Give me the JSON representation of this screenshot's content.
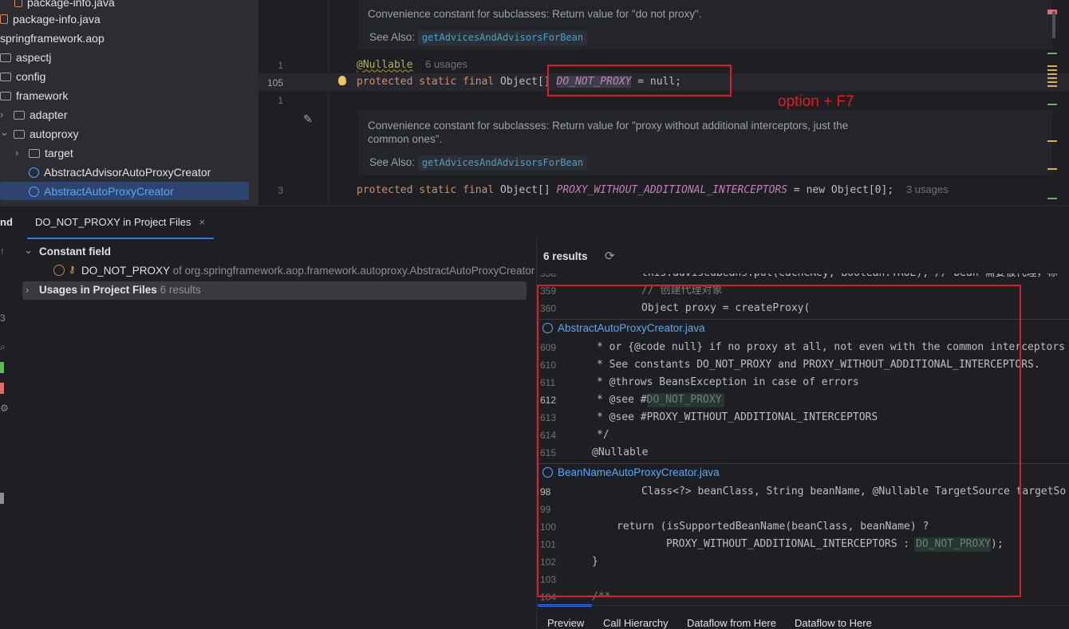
{
  "project_tree": {
    "items": [
      {
        "label": "package-info.java"
      },
      {
        "label": "package-info.java"
      },
      {
        "label": "springframework.aop"
      },
      {
        "label": "aspectj"
      },
      {
        "label": "config"
      },
      {
        "label": "framework"
      },
      {
        "label": "adapter"
      },
      {
        "label": "autoproxy"
      },
      {
        "label": "target"
      },
      {
        "label": "AbstractAdvisorAutoProxyCreator"
      },
      {
        "label": "AbstractAutoProxyCreator"
      }
    ]
  },
  "editor": {
    "doc1_text": "Convenience constant for subclasses: Return value for \"do not proxy\".",
    "see_also_label": "See Also:",
    "see_also_link": "getAdvicesAndAdvisorsForBean",
    "gutter": [
      "1",
      "105",
      "1",
      "3"
    ],
    "annotation": "@Nullable",
    "annotation_usages": "6 usages",
    "line105": {
      "kw1": "protected",
      "kw2": "static",
      "kw3": "final",
      "type": "Object[]",
      "name": "DO_NOT_PROXY",
      "rest": " = null;"
    },
    "doc2_text": "Convenience constant for subclasses: Return value for \"proxy without additional interceptors, just the common ones\".",
    "line_last": {
      "kw1": "protected",
      "kw2": "static",
      "kw3": "final",
      "type": "Object[]",
      "name": "PROXY_WITHOUT_ADDITIONAL_INTERCEPTORS",
      "rest": " = new Object[0];"
    },
    "last_usages": "3 usages",
    "shortcut_annotation": "option + F7"
  },
  "find": {
    "tool_label": "nd",
    "tab_label": "DO_NOT_PROXY in Project Files",
    "tree": {
      "group1": "Constant field",
      "constant_name": "DO_NOT_PROXY",
      "constant_location": "of org.springframework.aop.framework.autoproxy.AbstractAutoProxyCreator",
      "group2": "Usages in Project Files",
      "group2_count": "6 results"
    },
    "results_count": "6 results",
    "preview": {
      "top_lines": [
        {
          "num": "358",
          "code": "this.advisedBeans.put(cacheKey, Boolean.TRUE); // bean 需要被代理，标"
        },
        {
          "num": "359",
          "code": "// 创建代理对象"
        },
        {
          "num": "360",
          "code": "Object proxy = createProxy("
        }
      ],
      "file1": "AbstractAutoProxyCreator.java",
      "file1_lines": [
        {
          "num": "609",
          "code": "* or {@code null} if no proxy at all, not even with the common interceptors"
        },
        {
          "num": "610",
          "code": "* See constants DO_NOT_PROXY and PROXY_WITHOUT_ADDITIONAL_INTERCEPTORS."
        },
        {
          "num": "611",
          "code": "* @throws BeansException in case of errors"
        },
        {
          "num": "612",
          "code": "* @see #DO_NOT_PROXY"
        },
        {
          "num": "613",
          "code": "* @see #PROXY_WITHOUT_ADDITIONAL_INTERCEPTORS"
        },
        {
          "num": "614",
          "code": "*/"
        },
        {
          "num": "615",
          "code": "@Nullable"
        }
      ],
      "file2": "BeanNameAutoProxyCreator.java",
      "file2_lines": [
        {
          "num": "98",
          "code": "Class<?> beanClass, String beanName, @Nullable TargetSource targetSo"
        },
        {
          "num": "99",
          "code": ""
        },
        {
          "num": "100",
          "code": "return (isSupportedBeanName(beanClass, beanName) ?"
        },
        {
          "num": "101",
          "code": "PROXY_WITHOUT_ADDITIONAL_INTERCEPTORS : DO_NOT_PROXY);"
        },
        {
          "num": "102",
          "code": "}"
        },
        {
          "num": "103",
          "code": ""
        },
        {
          "num": "104",
          "code": "/**"
        }
      ]
    },
    "bottom_tabs": [
      "Preview",
      "Call Hierarchy",
      "Dataflow from Here",
      "Dataflow to Here"
    ]
  },
  "colors": {
    "accent": "#5aa9f7",
    "highlight_box": "#e01b24",
    "selection": "#2e436e"
  }
}
